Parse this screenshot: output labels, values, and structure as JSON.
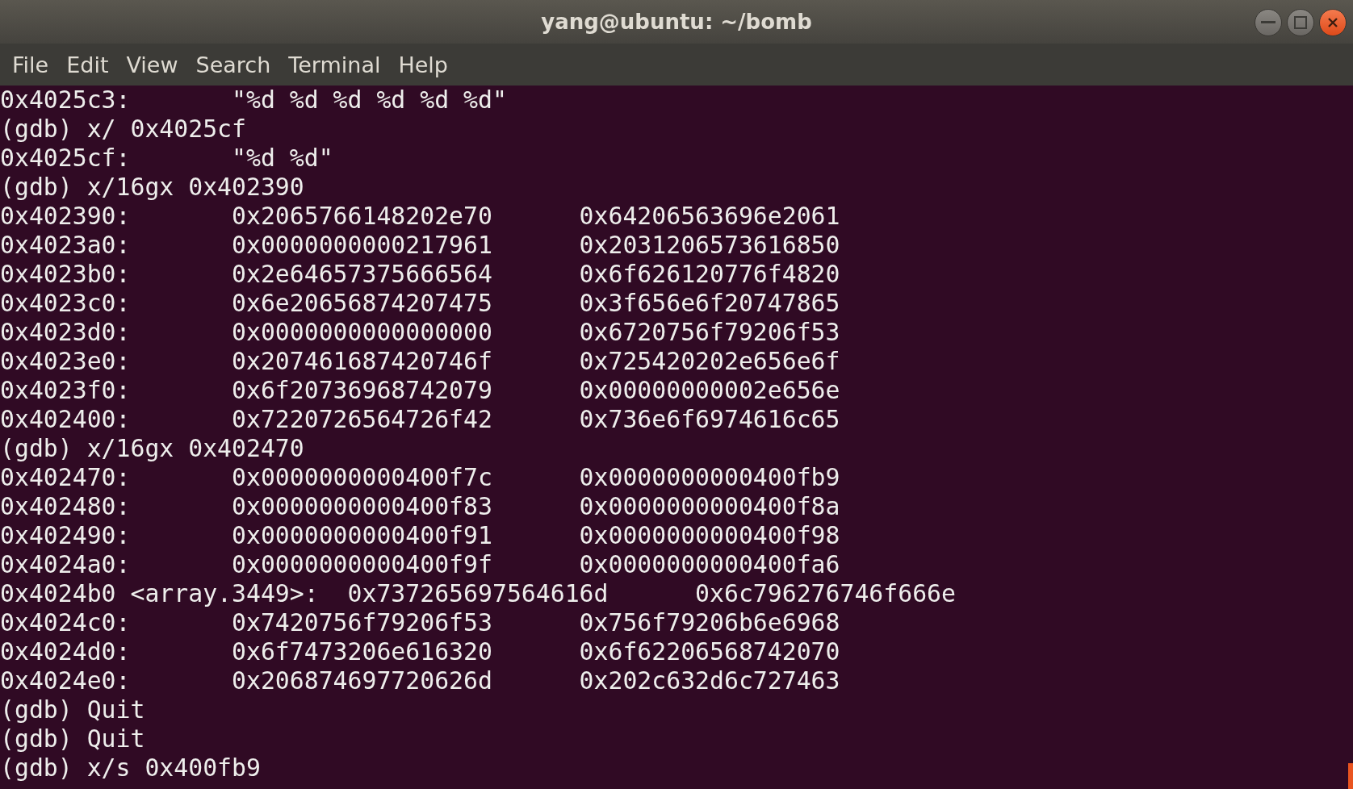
{
  "window": {
    "title": "yang@ubuntu: ~/bomb"
  },
  "menu": [
    "File",
    "Edit",
    "View",
    "Search",
    "Terminal",
    "Help"
  ],
  "terminal": {
    "lines": [
      "0x4025c3:\t\"%d %d %d %d %d %d\"",
      "(gdb) x/ 0x4025cf",
      "0x4025cf:\t\"%d %d\"",
      "(gdb) x/16gx 0x402390",
      "0x402390:\t0x2065766148202e70\t0x64206563696e2061",
      "0x4023a0:\t0x0000000000217961\t0x2031206573616850",
      "0x4023b0:\t0x2e64657375666564\t0x6f626120776f4820",
      "0x4023c0:\t0x6e20656874207475\t0x3f656e6f20747865",
      "0x4023d0:\t0x0000000000000000\t0x6720756f79206f53",
      "0x4023e0:\t0x207461687420746f\t0x725420202e656e6f",
      "0x4023f0:\t0x6f20736968742079\t0x00000000002e656e",
      "0x402400:\t0x7220726564726f42\t0x736e6f6974616c65",
      "(gdb) x/16gx 0x402470",
      "0x402470:\t0x0000000000400f7c\t0x0000000000400fb9",
      "0x402480:\t0x0000000000400f83\t0x0000000000400f8a",
      "0x402490:\t0x0000000000400f91\t0x0000000000400f98",
      "0x4024a0:\t0x0000000000400f9f\t0x0000000000400fa6",
      "0x4024b0 <array.3449>:\t0x737265697564616d\t0x6c796276746f666e",
      "0x4024c0:\t0x7420756f79206f53\t0x756f79206b6e6968",
      "0x4024d0:\t0x6f7473206e616320\t0x6f62206568742070",
      "0x4024e0:\t0x206874697720626d\t0x202c632d6c727463",
      "(gdb) Quit",
      "(gdb) Quit",
      "(gdb) x/s 0x400fb9"
    ]
  }
}
